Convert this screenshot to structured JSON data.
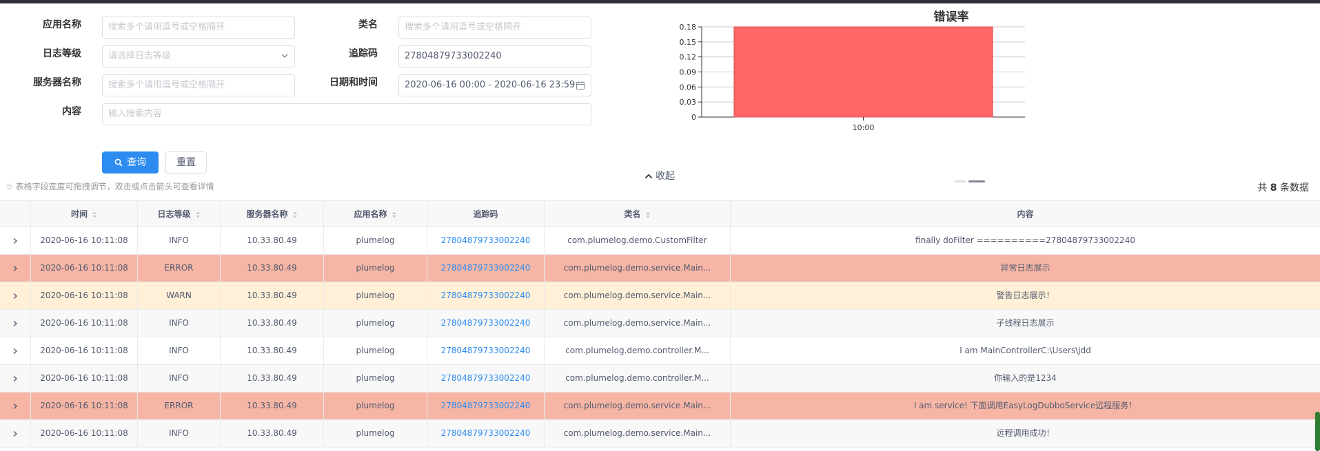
{
  "form": {
    "app_name_label": "应用名称",
    "app_name_placeholder": "搜索多个请用逗号或空格隔开",
    "class_name_label": "类名",
    "class_name_placeholder": "搜索多个请用逗号或空格隔开",
    "level_label": "日志等级",
    "level_placeholder": "请选择日志等级",
    "trace_label": "追踪码",
    "trace_value": "27804879733002240",
    "server_label": "服务器名称",
    "server_placeholder": "搜索多个请用逗号或空格隔开",
    "datetime_label": "日期和时间",
    "datetime_value": "2020-06-16 00:00 - 2020-06-16 23:59",
    "content_label": "内容",
    "content_placeholder": "输入搜索内容",
    "search_button": "查询",
    "reset_button": "重置"
  },
  "chart_data": {
    "type": "bar",
    "title": "错误率",
    "categories": [
      "10:00"
    ],
    "values": [
      0.18
    ],
    "yticks": [
      "0",
      "0.03",
      "0.06",
      "0.09",
      "0.12",
      "0.15",
      "0.18"
    ],
    "ylim": [
      0,
      0.18
    ],
    "xlabel": "",
    "ylabel": "",
    "grid": true,
    "bar_color": "#ff6666"
  },
  "collapse_label": "收起",
  "hint_text": "☆ 表格字段宽度可拖拽调节，双击或点击箭头可查看详情",
  "total": {
    "prefix": "共",
    "count": "8",
    "suffix": "条数据"
  },
  "table": {
    "headers": [
      "时间",
      "日志等级",
      "服务器名称",
      "应用名称",
      "追踪码",
      "类名",
      "内容"
    ],
    "rows": [
      {
        "time": "2020-06-16 10:11:08",
        "level": "INFO",
        "server": "10.33.80.49",
        "app": "plumelog",
        "trace": "27804879733002240",
        "class": "com.plumelog.demo.CustomFilter",
        "content": "finally doFilter ==========27804879733002240"
      },
      {
        "time": "2020-06-16 10:11:08",
        "level": "ERROR",
        "server": "10.33.80.49",
        "app": "plumelog",
        "trace": "27804879733002240",
        "class": "com.plumelog.demo.service.Main...",
        "content": "异常日志展示"
      },
      {
        "time": "2020-06-16 10:11:08",
        "level": "WARN",
        "server": "10.33.80.49",
        "app": "plumelog",
        "trace": "27804879733002240",
        "class": "com.plumelog.demo.service.Main...",
        "content": "警告日志展示！"
      },
      {
        "time": "2020-06-16 10:11:08",
        "level": "INFO",
        "server": "10.33.80.49",
        "app": "plumelog",
        "trace": "27804879733002240",
        "class": "com.plumelog.demo.service.Main...",
        "content": "子线程日志展示"
      },
      {
        "time": "2020-06-16 10:11:08",
        "level": "INFO",
        "server": "10.33.80.49",
        "app": "plumelog",
        "trace": "27804879733002240",
        "class": "com.plumelog.demo.controller.M...",
        "content": "I am MainControllerC:\\Users\\jdd"
      },
      {
        "time": "2020-06-16 10:11:08",
        "level": "INFO",
        "server": "10.33.80.49",
        "app": "plumelog",
        "trace": "27804879733002240",
        "class": "com.plumelog.demo.controller.M...",
        "content": "你输入的是1234"
      },
      {
        "time": "2020-06-16 10:11:08",
        "level": "ERROR",
        "server": "10.33.80.49",
        "app": "plumelog",
        "trace": "27804879733002240",
        "class": "com.plumelog.demo.service.Main...",
        "content": "I am service! 下面调用EasyLogDubboService远程服务！"
      },
      {
        "time": "2020-06-16 10:11:08",
        "level": "INFO",
        "server": "10.33.80.49",
        "app": "plumelog",
        "trace": "27804879733002240",
        "class": "com.plumelog.demo.service.Main...",
        "content": "远程调用成功！"
      }
    ]
  },
  "colors": {
    "primary": "#2d8cf0",
    "error_row": "#f7b6a5",
    "warn_row": "#fff0d7"
  }
}
